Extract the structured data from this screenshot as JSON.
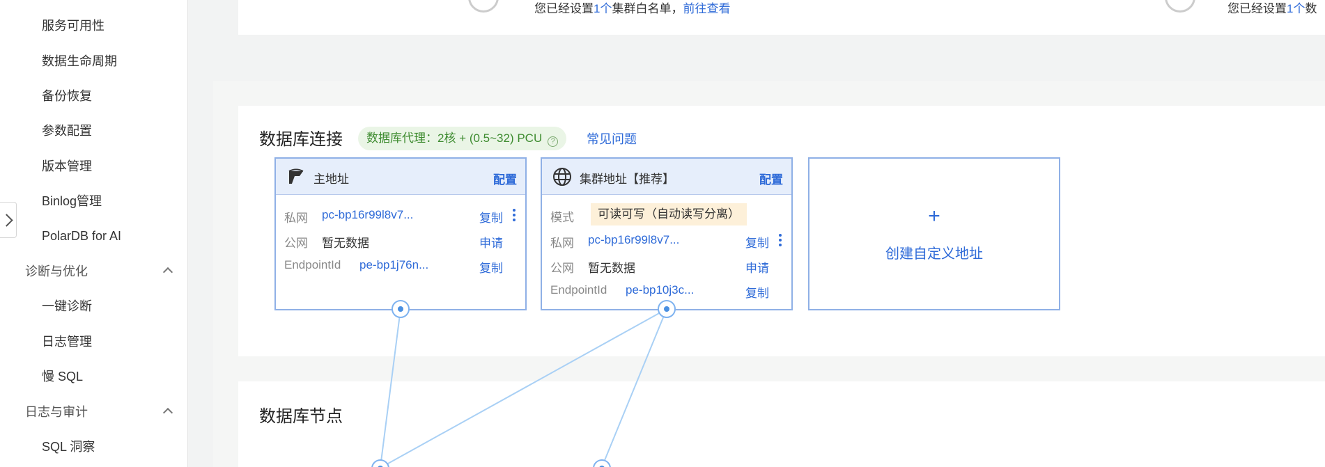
{
  "sidebar": {
    "items": [
      {
        "label": "服务可用性"
      },
      {
        "label": "数据生命周期"
      },
      {
        "label": "备份恢复"
      },
      {
        "label": "参数配置"
      },
      {
        "label": "版本管理"
      },
      {
        "label": "Binlog管理"
      },
      {
        "label": "PolarDB for AI"
      }
    ],
    "group_diag": {
      "label": "诊断与优化"
    },
    "diag_items": [
      {
        "label": "一键诊断"
      },
      {
        "label": "日志管理"
      },
      {
        "label": "慢 SQL"
      }
    ],
    "group_audit": {
      "label": "日志与审计"
    },
    "audit_items": [
      {
        "label": "SQL 洞察"
      }
    ]
  },
  "whitelist_notice": {
    "prefix": "您已经设置",
    "count": "1个",
    "suffix": "集群白名单，",
    "link": "前往查看",
    "right_prefix": "您已经设置",
    "right_count": "1个",
    "right_suffix": "数"
  },
  "connection": {
    "title": "数据库连接",
    "proxy_badge": "数据库代理：2核 + (0.5~32) PCU",
    "faq": "常见问题",
    "primary": {
      "title": "主地址",
      "config": "配置",
      "rows": [
        {
          "label": "私网",
          "value": "pc-bp16r99l8v7...",
          "action": "复制"
        },
        {
          "label": "公网",
          "value": "暂无数据",
          "action": "申请"
        },
        {
          "label": "EndpointId",
          "value": "pe-bp1j76n...",
          "action": "复制"
        }
      ]
    },
    "cluster": {
      "title": "集群地址【推荐】",
      "config": "配置",
      "mode_label": "模式",
      "mode_value": "可读可写（自动读写分离）",
      "rows": [
        {
          "label": "私网",
          "value": "pc-bp16r99l8v7...",
          "action": "复制"
        },
        {
          "label": "公网",
          "value": "暂无数据",
          "action": "申请"
        },
        {
          "label": "EndpointId",
          "value": "pe-bp10j3c...",
          "action": "复制"
        }
      ]
    },
    "create": {
      "plus": "+",
      "label": "创建自定义地址"
    }
  },
  "nodes": {
    "title": "数据库节点"
  },
  "colors": {
    "link": "#2f6bd8",
    "card_border": "#8fb0e6",
    "card_header": "#e6eefb",
    "badge_bg": "#eaf5e6",
    "badge_text": "#3d8b2f",
    "mode_bg": "#fdf0d9",
    "connector": "#a9d0f5"
  },
  "icons": {
    "primary": "polardb-logo-icon",
    "cluster": "globe-icon",
    "help": "question-circle-icon",
    "expand": "chevron-right-icon",
    "collapse": "chevron-up-icon"
  }
}
